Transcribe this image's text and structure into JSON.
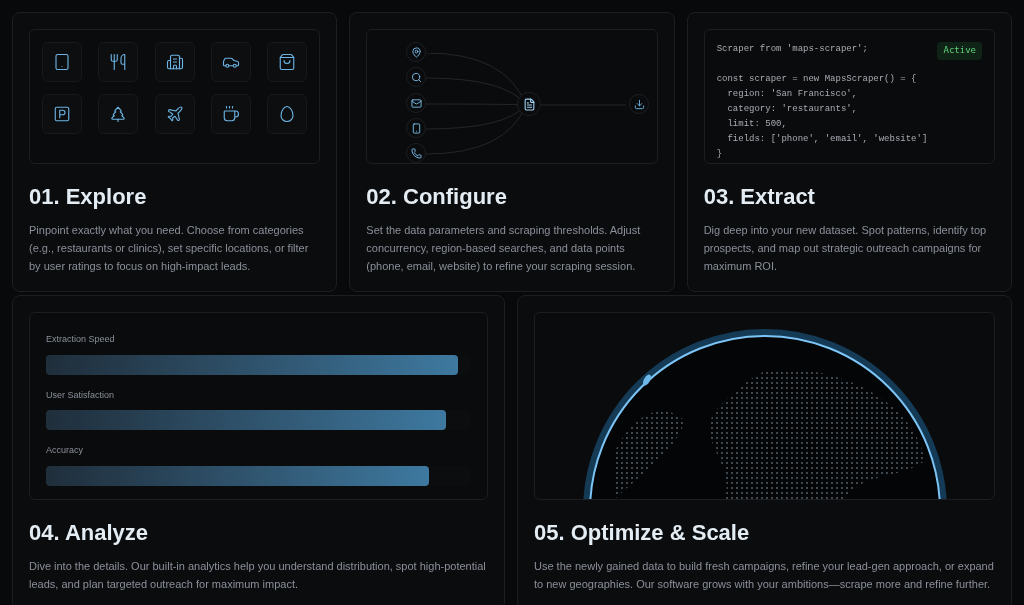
{
  "steps": [
    {
      "title": "01. Explore",
      "description": "Pinpoint exactly what you need. Choose from categories (e.g., restaurants or clinics), set specific locations, or filter by user ratings to focus on high-impact leads."
    },
    {
      "title": "02. Configure",
      "description": "Set the data parameters and scraping thresholds. Adjust concurrency, region-based searches, and data points (phone, email, website) to refine your scraping session."
    },
    {
      "title": "03. Extract",
      "description": "Dig deep into your new dataset. Spot patterns, identify top prospects, and map out strategic outreach campaigns for maximum ROI."
    },
    {
      "title": "04. Analyze",
      "description": "Dive into the details. Our built-in analytics help you understand distribution, spot high-potential leads, and plan targeted outreach for maximum impact."
    },
    {
      "title": "05. Optimize & Scale",
      "description": "Use the newly gained data to build fresh campaigns, refine your lead-gen approach, or expand to new geographies. Our software grows with your ambitions—scrape more and refine further."
    }
  ],
  "code": {
    "badge": "Active",
    "blocks": [
      [
        "Scraper from 'maps-scraper';"
      ],
      [
        "const scraper = new MapsScraper() = {",
        "  region: 'San Francisco',",
        "  category: 'restaurants',",
        "  limit: 500,",
        "  fields: ['phone', 'email', 'website']",
        "}"
      ]
    ]
  },
  "metrics": [
    {
      "label": "Extraction Speed",
      "level": 0.97
    },
    {
      "label": "User Satisfaction",
      "level": 0.94
    },
    {
      "label": "Accuracy",
      "level": 0.9
    }
  ]
}
